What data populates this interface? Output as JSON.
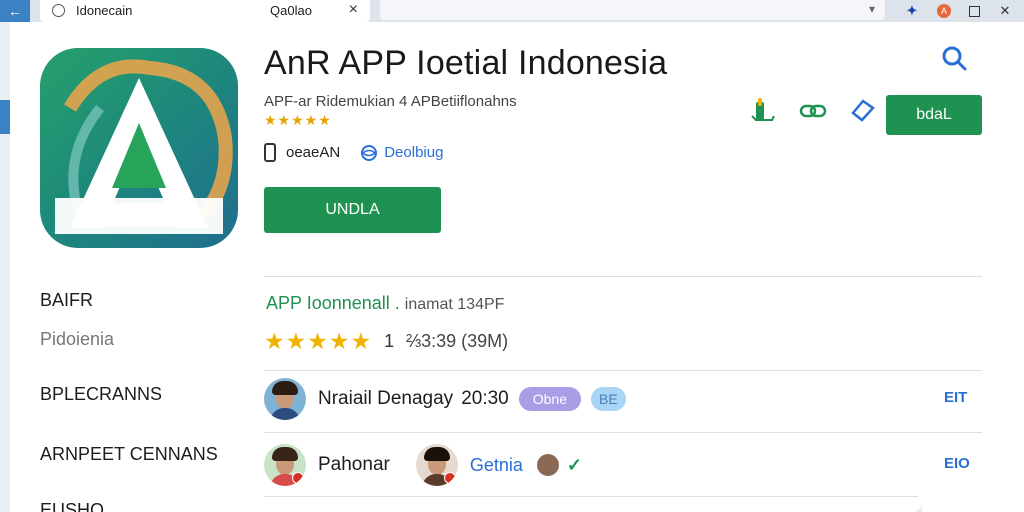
{
  "browser": {
    "back_icon": "arrow-left-icon",
    "tab": {
      "title": "Idonecain",
      "subtitle": "Qa0lao",
      "close": "×"
    },
    "omnibox_caret": "▾",
    "icons": [
      "pin-icon",
      "avatar-icon",
      "minimize-icon",
      "maximize-icon",
      "close-icon"
    ],
    "pin": "✦",
    "avatar_letter": "A",
    "minimize": "—",
    "close": "✕"
  },
  "app": {
    "title": "AnR APP Ioetial Indonesia",
    "subtitle": "APF-ar Ridemukian 4 APBetiiflonahns",
    "stars": "★★★★★",
    "meta_a": "oeaeAN",
    "meta_b": "Deolbiug",
    "install_label": "UNDLA"
  },
  "actions": {
    "share_label": "bdaL",
    "icons": [
      "thumb-icon",
      "link-icon",
      "bookmark-icon",
      "search-icon"
    ]
  },
  "sidebar": {
    "labels": [
      "BAIFR",
      "Pidoienia",
      "BPLECRANNS",
      "ARNPEET CENNANS",
      "EUSHO"
    ]
  },
  "ratings": {
    "title_a": "APP Ioonnenall .",
    "title_b": "inamat 134PF",
    "stars": "★★★★★",
    "count": "1",
    "ago": "⅔3:39 (39M)"
  },
  "reviews": [
    {
      "name": "Nraiail Denagay",
      "time": "20:30",
      "pill1": "Obne",
      "pill2": "BE",
      "action": "EIT"
    },
    {
      "name": "Pahonar",
      "link": "Getnia",
      "check": "✓",
      "action": "EIO"
    }
  ],
  "colors": {
    "accent_green": "#1f9150",
    "link_blue": "#2a6fd6",
    "star": "#f0b400",
    "pill_purple": "#a99de6"
  }
}
